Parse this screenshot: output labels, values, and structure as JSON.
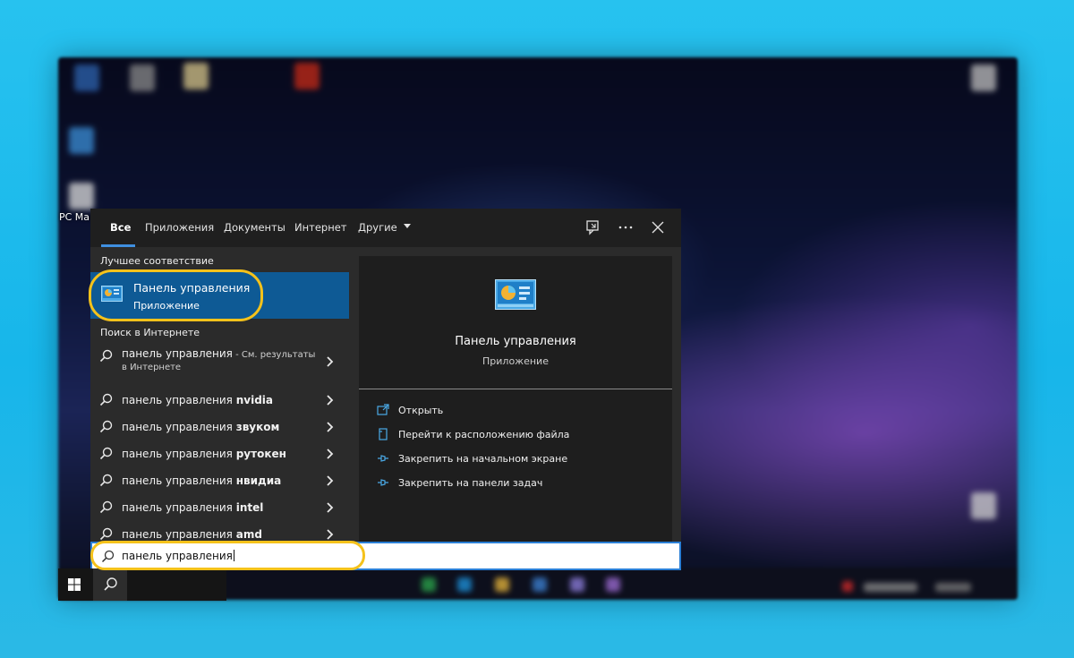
{
  "desktop": {
    "pc_label": "PC Mana"
  },
  "tabs": [
    {
      "label": "Все",
      "active": true
    },
    {
      "label": "Приложения"
    },
    {
      "label": "Документы"
    },
    {
      "label": "Интернет"
    },
    {
      "label": "Другие"
    }
  ],
  "header_icons": [
    "feedback-icon",
    "more-icon",
    "close-icon"
  ],
  "left": {
    "best_match_title": "Лучшее соответствие",
    "best_match": {
      "name": "Панель управления",
      "type": "Приложение"
    },
    "web_title": "Поиск в Интернете",
    "web_first": {
      "query": "панель управления",
      "suffix": " - См. результаты",
      "line2": "в Интернете"
    },
    "suggestions": [
      {
        "base": "панель управления ",
        "bold": "nvidia"
      },
      {
        "base": "панель управления ",
        "bold": "звуком"
      },
      {
        "base": "панель управления ",
        "bold": "рутокен"
      },
      {
        "base": "панель управления ",
        "bold": "нвидиа"
      },
      {
        "base": "панель управления ",
        "bold": "intel"
      },
      {
        "base": "панель управления ",
        "bold": "amd"
      }
    ]
  },
  "right": {
    "title": "Панель управления",
    "subtitle": "Приложение",
    "actions": [
      {
        "label": "Открыть",
        "icon": "open-icon"
      },
      {
        "label": "Перейти к расположению файла",
        "icon": "file-location-icon"
      },
      {
        "label": "Закрепить на начальном экране",
        "icon": "pin-icon"
      },
      {
        "label": "Закрепить на панели задач",
        "icon": "pin-icon"
      }
    ]
  },
  "search": {
    "value": "панель управления"
  },
  "colors": {
    "accent": "#0e5a95",
    "highlight": "#f5c21b",
    "search_border": "#2a7fd6"
  }
}
